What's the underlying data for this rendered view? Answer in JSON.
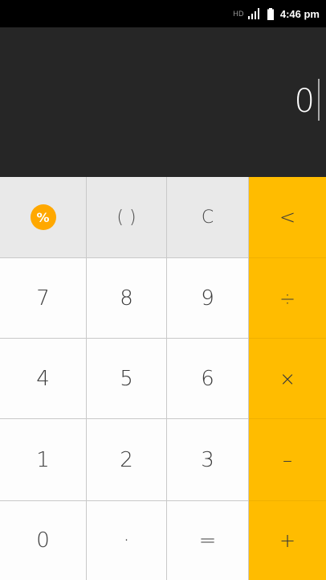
{
  "status_bar": {
    "network_label": "HD",
    "time": "4:46 pm",
    "signal_icon": "signal-icon",
    "battery_icon": "battery-icon"
  },
  "display": {
    "value": "0"
  },
  "keys": {
    "percent": "%",
    "parentheses": "( )",
    "clear": "C",
    "backspace": "<",
    "seven": "7",
    "eight": "8",
    "nine": "9",
    "divide": "÷",
    "four": "4",
    "five": "5",
    "six": "6",
    "multiply": "×",
    "one": "1",
    "two": "2",
    "three": "3",
    "minus": "–",
    "zero": "0",
    "decimal": "·",
    "equals": "=",
    "plus": "+"
  },
  "colors": {
    "operator_column": "#ffbc00",
    "display_background": "#262626",
    "percent_badge": "#ffa800"
  }
}
